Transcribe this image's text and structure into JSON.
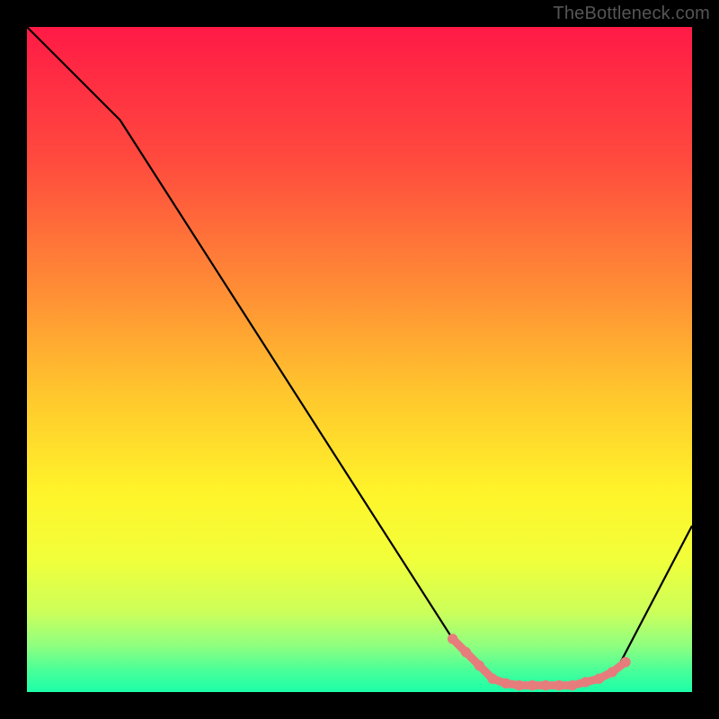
{
  "watermark": "TheBottleneck.com",
  "chart_data": {
    "type": "line",
    "title": "",
    "xlabel": "",
    "ylabel": "",
    "xlim": [
      0,
      100
    ],
    "ylim": [
      0,
      100
    ],
    "x": [
      0,
      14,
      64,
      70,
      73,
      76,
      78,
      80,
      83,
      86,
      89,
      100
    ],
    "y": [
      100,
      86,
      8,
      2,
      1,
      1,
      1,
      1,
      1,
      2,
      4,
      25
    ],
    "gradient_stops": [
      {
        "offset": 0.0,
        "color": "#ff1a46"
      },
      {
        "offset": 0.2,
        "color": "#ff4a3e"
      },
      {
        "offset": 0.4,
        "color": "#ff8f35"
      },
      {
        "offset": 0.55,
        "color": "#ffc62d"
      },
      {
        "offset": 0.7,
        "color": "#fff42a"
      },
      {
        "offset": 0.8,
        "color": "#f1ff3a"
      },
      {
        "offset": 0.88,
        "color": "#ccff5a"
      },
      {
        "offset": 0.93,
        "color": "#8fff80"
      },
      {
        "offset": 0.97,
        "color": "#45ff9a"
      },
      {
        "offset": 1.0,
        "color": "#1cffa8"
      }
    ],
    "highlight_markers": {
      "x": [
        64,
        66,
        68,
        70,
        72,
        74,
        76,
        78,
        80,
        82,
        84,
        86,
        88,
        90
      ],
      "y": [
        8,
        6,
        4,
        2,
        1.3,
        1,
        1,
        1,
        1,
        1,
        1.5,
        2,
        3,
        4.5
      ]
    }
  }
}
